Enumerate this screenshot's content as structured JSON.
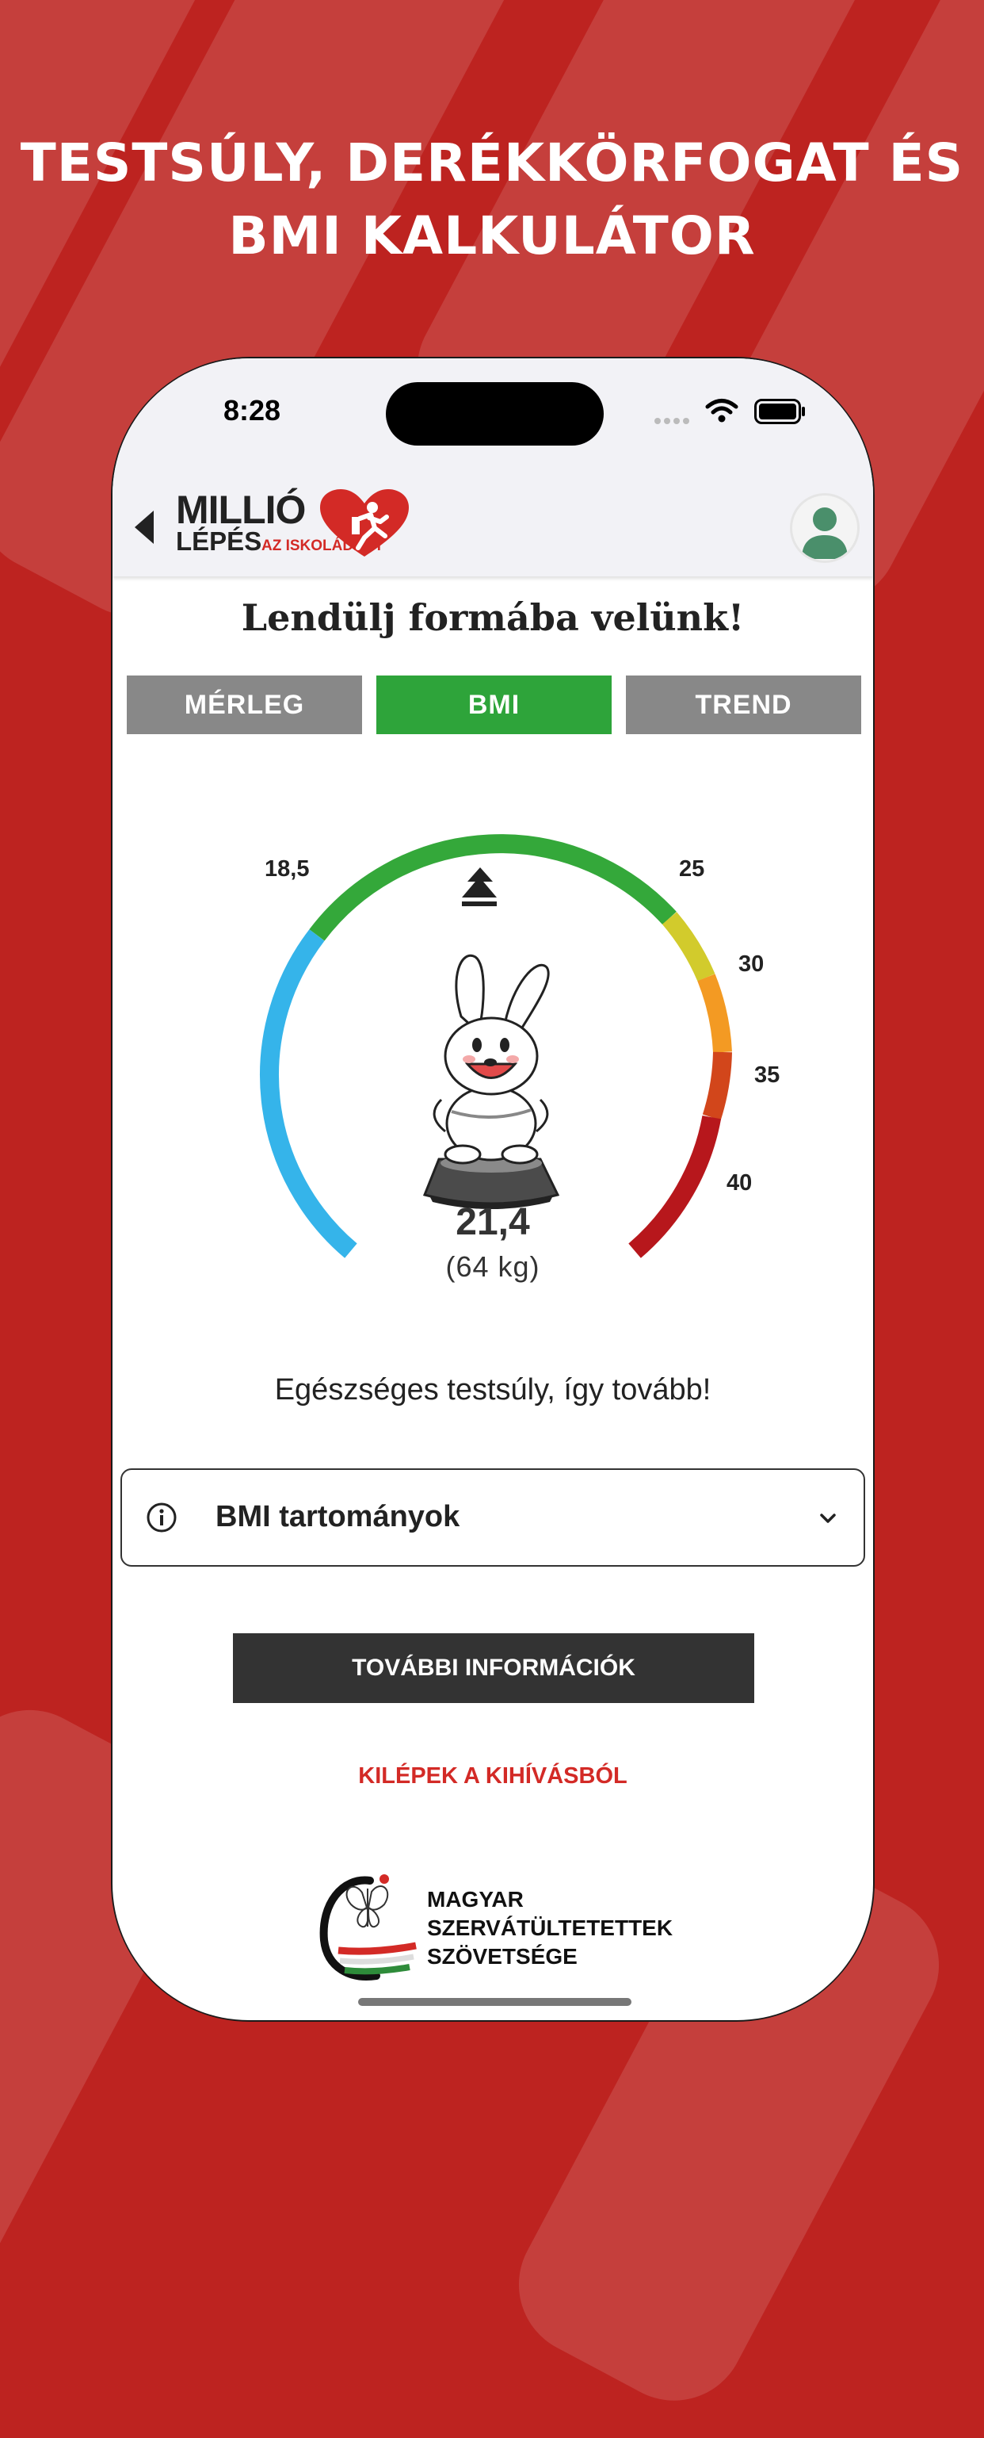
{
  "headline": {
    "line1": "TESTSÚLY, DERÉKKÖRFOGAT ÉS",
    "line2": "BMI KALKULÁTOR"
  },
  "status_bar": {
    "time": "8:28"
  },
  "header": {
    "logo": {
      "line1": "MILLIÓ",
      "line2": "LÉPÉS",
      "line3": "AZ ISKOLÁDÉRT"
    }
  },
  "tagline": "Lendülj formába velünk!",
  "tabs": [
    {
      "label": "MÉRLEG",
      "active": false
    },
    {
      "label": "BMI",
      "active": true
    },
    {
      "label": "TREND",
      "active": false
    }
  ],
  "gauge": {
    "thresholds": [
      "18,5",
      "25",
      "30",
      "35",
      "40"
    ],
    "bmi": "21,4",
    "weight": "(64 kg)",
    "colors": {
      "underweight": "#35b4ea",
      "normal": "#34a83a",
      "overweight": "#d2cb2c",
      "obese1": "#f39a23",
      "obese2": "#d2461b",
      "obese3": "#b7171c"
    }
  },
  "message": "Egészséges testsúly, így tovább!",
  "accordion": {
    "label": "BMI tartományok"
  },
  "buttons": {
    "more_info": "TOVÁBBI INFORMÁCIÓK",
    "exit": "KILÉPEK A KIHÍVÁSBÓL"
  },
  "footer": {
    "org_line1": "MAGYAR",
    "org_line2": "SZERVÁTÜLTETETTEK",
    "org_line3": "SZÖVETSÉGE"
  },
  "icons": [
    "back-arrow-icon",
    "heart-runner-logo-icon",
    "user-avatar-icon",
    "wifi-icon",
    "battery-icon",
    "cellular-icon",
    "info-icon",
    "chevron-down-icon",
    "pointer-triangle-icon",
    "bunny-scale-mascot-icon",
    "butterfly-logo-icon"
  ]
}
